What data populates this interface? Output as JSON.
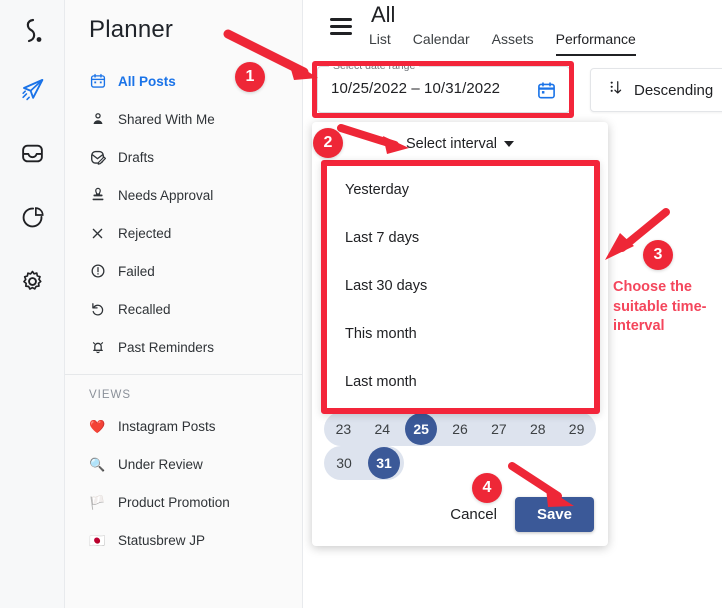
{
  "rail": {
    "logo": "statusbrew-logo",
    "items": [
      {
        "name": "publish-icon",
        "label": "Publish",
        "active": true
      },
      {
        "name": "inbox-icon",
        "label": "Inbox",
        "active": false
      },
      {
        "name": "reports-icon",
        "label": "Reports",
        "active": false
      },
      {
        "name": "settings-icon",
        "label": "Settings",
        "active": false
      }
    ]
  },
  "sidebar": {
    "title": "Planner",
    "items": [
      {
        "label": "All Posts",
        "icon": "calendar-icon",
        "active": true
      },
      {
        "label": "Shared With Me",
        "icon": "person-icon",
        "active": false
      },
      {
        "label": "Drafts",
        "icon": "draft-pencil-icon",
        "active": false
      },
      {
        "label": "Needs Approval",
        "icon": "stamp-icon",
        "active": false
      },
      {
        "label": "Rejected",
        "icon": "close-x-icon",
        "active": false
      },
      {
        "label": "Failed",
        "icon": "alert-circle-icon",
        "active": false
      },
      {
        "label": "Recalled",
        "icon": "undo-arrow-icon",
        "active": false
      },
      {
        "label": "Past Reminders",
        "icon": "bell-icon",
        "active": false
      }
    ],
    "section_label": "VIEWS",
    "views": [
      {
        "label": "Instagram Posts",
        "emoji": "❤️"
      },
      {
        "label": "Under Review",
        "emoji": "🔍"
      },
      {
        "label": "Product Promotion",
        "emoji": "🏳️"
      },
      {
        "label": "Statusbrew JP",
        "emoji": "🇯🇵"
      }
    ]
  },
  "header": {
    "menu_icon": "hamburger-icon",
    "title": "All",
    "tabs": [
      {
        "label": "List",
        "active": false
      },
      {
        "label": "Calendar",
        "active": false
      },
      {
        "label": "Assets",
        "active": false
      },
      {
        "label": "Performance",
        "active": true
      }
    ]
  },
  "toolbar": {
    "date_field_legend": "Select date range",
    "date_field_value": "10/25/2022 – 10/31/2022",
    "calendar_icon": "calendar-icon",
    "sort_button_label": "Descending",
    "sort_icon": "sort-descending-icon"
  },
  "picker": {
    "interval_trigger_label": "Select interval",
    "interval_options": [
      "Yesterday",
      "Last 7 days",
      "Last 30 days",
      "This month",
      "Last month"
    ],
    "calendar_rows": [
      [
        {
          "day": "23",
          "selected": false,
          "in_range": true,
          "range_start": true
        },
        {
          "day": "24",
          "selected": false,
          "in_range": true
        },
        {
          "day": "25",
          "selected": true,
          "in_range": true
        },
        {
          "day": "26",
          "selected": false,
          "in_range": true
        },
        {
          "day": "27",
          "selected": false,
          "in_range": true
        },
        {
          "day": "28",
          "selected": false,
          "in_range": true
        },
        {
          "day": "29",
          "selected": false,
          "in_range": true,
          "range_end": true
        }
      ],
      [
        {
          "day": "30",
          "selected": false,
          "in_range": true,
          "range_start": true
        },
        {
          "day": "31",
          "selected": true,
          "in_range": true,
          "range_end": true
        }
      ]
    ],
    "cancel_label": "Cancel",
    "save_label": "Save"
  },
  "annotations": {
    "badges": [
      "1",
      "2",
      "3",
      "4"
    ],
    "note": "Choose the suitable time-interval",
    "accent_color": "#f3253a",
    "badge_color": "#ee2737"
  },
  "colors": {
    "brand_blue": "#1a73e8",
    "select_blue": "#3b5998",
    "range_blue": "#dde3ee",
    "sidebar_bg": "#fafafa",
    "rail_bg": "#f7f8f9"
  }
}
